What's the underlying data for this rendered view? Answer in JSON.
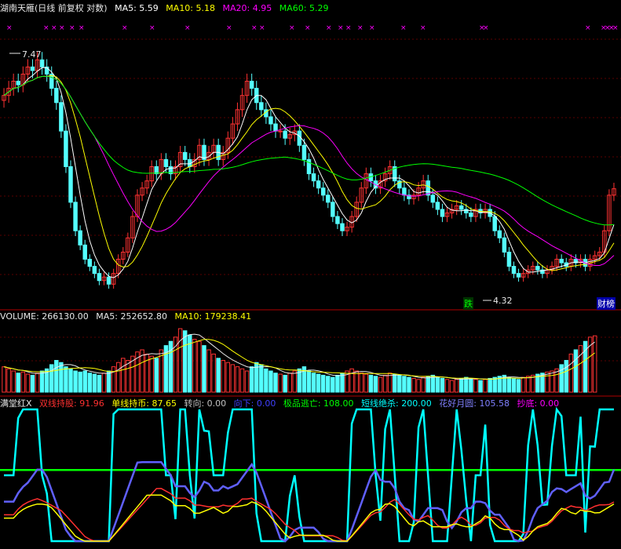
{
  "main": {
    "legend": [
      {
        "text": "湖南天雁(日线 前复权 对数)",
        "color": "#e8e8e8"
      },
      {
        "text": "MA5: 5.59",
        "color": "#ffffff"
      },
      {
        "text": "MA10: 5.18",
        "color": "#ffff00"
      },
      {
        "text": "MA20: 4.95",
        "color": "#ff00ff"
      },
      {
        "text": "MA60: 5.29",
        "color": "#00ff00"
      }
    ],
    "high_label": "7.47",
    "low_label": "4.32",
    "event_die": "跌",
    "event_caibang": "财榜"
  },
  "volume": {
    "legend": [
      {
        "text": "VOLUME: 266130.00",
        "color": "#e8e8e8"
      },
      {
        "text": "MA5: 252652.80",
        "color": "#e8e8e8"
      },
      {
        "text": "MA10: 179238.41",
        "color": "#ffff00"
      }
    ]
  },
  "indicator": {
    "legend": [
      {
        "text": "满堂红X",
        "color": "#e8e8e8"
      },
      {
        "text": "双线持股: 91.96",
        "color": "#ff3030"
      },
      {
        "text": "单线持币: 87.65",
        "color": "#ffff00"
      },
      {
        "text": "转向: 0.00",
        "color": "#c0c0c0"
      },
      {
        "text": "向下: 0.00",
        "color": "#4040ff"
      },
      {
        "text": "极品逃亡: 108.00",
        "color": "#00ff00"
      },
      {
        "text": "短线绝杀: 200.00",
        "color": "#00ffff"
      },
      {
        "text": "花好月圆: 105.58",
        "color": "#8080ff"
      },
      {
        "text": "抄底: 0.00",
        "color": "#ff00ff"
      }
    ]
  },
  "colors": {
    "up": "#ff3232",
    "down": "#54ffff",
    "ma5": "#ffffff",
    "ma10": "#ffff00",
    "ma20": "#ff00ff",
    "ma60": "#00ff00",
    "divider": "#b00000"
  },
  "chart_data": [
    {
      "type": "candlestick",
      "title": "湖南天雁(日线 前复权 对数)",
      "close": [
        6.9,
        7.0,
        7.1,
        7.05,
        7.2,
        7.3,
        7.25,
        7.4,
        7.3,
        7.2,
        7.0,
        6.8,
        6.4,
        5.9,
        5.4,
        5.0,
        4.8,
        4.6,
        4.5,
        4.4,
        4.3,
        4.35,
        4.25,
        4.4,
        4.6,
        4.7,
        4.9,
        5.2,
        5.5,
        5.6,
        5.7,
        5.9,
        5.8,
        6.0,
        5.9,
        5.8,
        5.9,
        6.1,
        6.0,
        5.9,
        6.0,
        6.2,
        6.0,
        6.1,
        6.2,
        6.0,
        6.1,
        6.3,
        6.5,
        6.7,
        6.9,
        7.1,
        7.0,
        6.8,
        6.7,
        6.6,
        6.5,
        6.4,
        6.4,
        6.3,
        6.35,
        6.4,
        6.2,
        6.0,
        5.8,
        5.7,
        5.6,
        5.5,
        5.4,
        5.2,
        5.1,
        5.0,
        5.05,
        5.2,
        5.4,
        5.6,
        5.8,
        5.7,
        5.6,
        5.7,
        5.8,
        5.9,
        5.7,
        5.6,
        5.5,
        5.45,
        5.5,
        5.6,
        5.7,
        5.5,
        5.4,
        5.3,
        5.2,
        5.25,
        5.3,
        5.35,
        5.3,
        5.25,
        5.2,
        5.3,
        5.25,
        5.3,
        5.2,
        5.0,
        4.9,
        4.7,
        4.5,
        4.4,
        4.35,
        4.4,
        4.45,
        4.5,
        4.45,
        4.4,
        4.45,
        4.5,
        4.6,
        4.55,
        4.5,
        4.6,
        4.55,
        4.6,
        4.5,
        4.6,
        4.65,
        4.7,
        5.0,
        5.5,
        5.59
      ],
      "volume": [
        120000,
        110000,
        100000,
        90000,
        95000,
        85000,
        80000,
        90000,
        100000,
        110000,
        130000,
        150000,
        140000,
        120000,
        110000,
        100000,
        95000,
        100000,
        90000,
        85000,
        80000,
        90000,
        100000,
        120000,
        140000,
        160000,
        150000,
        170000,
        190000,
        200000,
        180000,
        170000,
        160000,
        200000,
        220000,
        240000,
        260000,
        300000,
        290000,
        270000,
        250000,
        240000,
        220000,
        200000,
        180000,
        160000,
        150000,
        140000,
        130000,
        120000,
        110000,
        100000,
        120000,
        140000,
        130000,
        110000,
        100000,
        90000,
        85000,
        80000,
        90000,
        100000,
        110000,
        120000,
        100000,
        90000,
        85000,
        80000,
        75000,
        70000,
        80000,
        90000,
        100000,
        110000,
        100000,
        90000,
        85000,
        80000,
        75000,
        70000,
        80000,
        90000,
        85000,
        80000,
        75000,
        70000,
        65000,
        60000,
        70000,
        75000,
        80000,
        70000,
        65000,
        60000,
        55000,
        60000,
        65000,
        70000,
        65000,
        60000,
        55000,
        60000,
        65000,
        70000,
        75000,
        80000,
        70000,
        65000,
        60000,
        70000,
        75000,
        80000,
        85000,
        90000,
        95000,
        100000,
        110000,
        130000,
        150000,
        180000,
        200000,
        220000,
        240000,
        260000,
        266130
      ]
    }
  ]
}
